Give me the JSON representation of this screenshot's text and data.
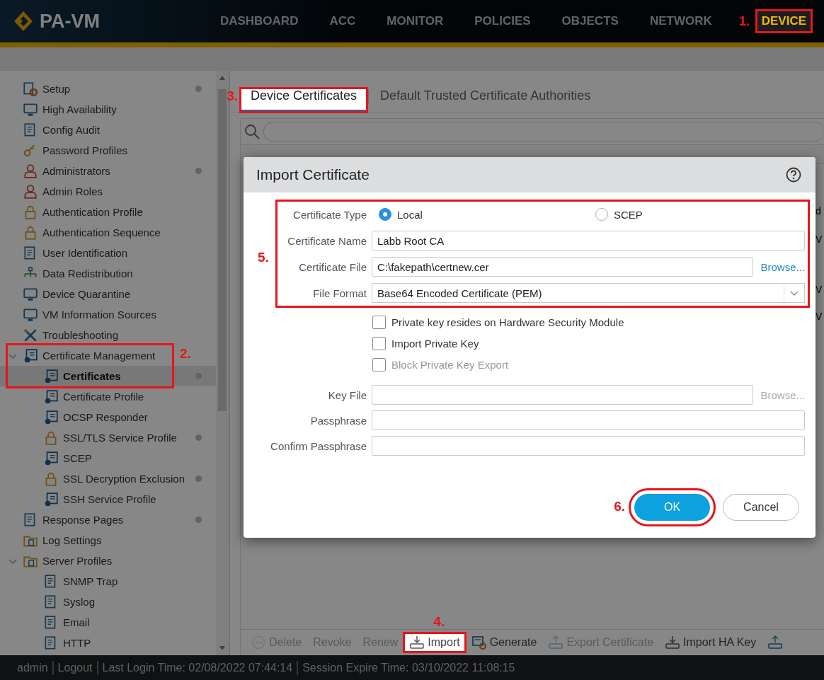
{
  "header": {
    "logo": "PA-VM",
    "nav": [
      {
        "label": "DASHBOARD",
        "selected": false
      },
      {
        "label": "ACC",
        "selected": false
      },
      {
        "label": "MONITOR",
        "selected": false
      },
      {
        "label": "POLICIES",
        "selected": false
      },
      {
        "label": "OBJECTS",
        "selected": false
      },
      {
        "label": "NETWORK",
        "selected": false
      },
      {
        "label": "DEVICE",
        "selected": true,
        "callout": "1."
      }
    ]
  },
  "sidebar": {
    "items": [
      {
        "label": "Setup",
        "selected": false,
        "dot": true
      },
      {
        "label": "High Availability",
        "selected": false,
        "dot": false
      },
      {
        "label": "Config Audit",
        "selected": false,
        "dot": false
      },
      {
        "label": "Password Profiles",
        "selected": false,
        "dot": false
      },
      {
        "label": "Administrators",
        "selected": false,
        "dot": true
      },
      {
        "label": "Admin Roles",
        "selected": false,
        "dot": false
      },
      {
        "label": "Authentication Profile",
        "selected": false,
        "dot": false
      },
      {
        "label": "Authentication Sequence",
        "selected": false,
        "dot": false
      },
      {
        "label": "User Identification",
        "selected": false,
        "dot": false
      },
      {
        "label": "Data Redistribution",
        "selected": false,
        "dot": false
      },
      {
        "label": "Device Quarantine",
        "selected": false,
        "dot": false
      },
      {
        "label": "VM Information Sources",
        "selected": false,
        "dot": false
      },
      {
        "label": "Troubleshooting",
        "selected": false,
        "dot": false
      },
      {
        "label": "Certificate Management",
        "selected": false,
        "dot": false,
        "expanded": true,
        "callout": "2.",
        "children": [
          {
            "label": "Certificates",
            "selected": true,
            "dot": true
          },
          {
            "label": "Certificate Profile",
            "selected": false,
            "dot": false
          },
          {
            "label": "OCSP Responder",
            "selected": false,
            "dot": false
          },
          {
            "label": "SSL/TLS Service Profile",
            "selected": false,
            "dot": true
          },
          {
            "label": "SCEP",
            "selected": false,
            "dot": false
          },
          {
            "label": "SSL Decryption Exclusion",
            "selected": false,
            "dot": true
          },
          {
            "label": "SSH Service Profile",
            "selected": false,
            "dot": false
          }
        ]
      },
      {
        "label": "Response Pages",
        "selected": false,
        "dot": true
      },
      {
        "label": "Log Settings",
        "selected": false,
        "dot": false
      },
      {
        "label": "Server Profiles",
        "selected": false,
        "dot": false,
        "expanded": true,
        "children": [
          {
            "label": "SNMP Trap",
            "selected": false,
            "dot": false
          },
          {
            "label": "Syslog",
            "selected": false,
            "dot": false
          },
          {
            "label": "Email",
            "selected": false,
            "dot": false
          },
          {
            "label": "HTTP",
            "selected": false,
            "dot": false
          }
        ]
      }
    ]
  },
  "tabs": [
    {
      "label": "Device Certificates",
      "selected": true,
      "callout": "3."
    },
    {
      "label": "Default Trusted Certificate Authorities",
      "selected": false
    }
  ],
  "table": {
    "rows": [
      {
        "column_1": "d"
      },
      {
        "column_1": "V"
      },
      {
        "column_1": "V"
      },
      {
        "column_1": "V"
      }
    ]
  },
  "toolbar": [
    {
      "kind": "delete",
      "label": "Delete",
      "disabled": true
    },
    {
      "kind": "plain",
      "label": "Revoke",
      "disabled": true
    },
    {
      "kind": "plain",
      "label": "Renew",
      "disabled": true
    },
    {
      "kind": "import",
      "label": "Import",
      "disabled": false,
      "callout": "4."
    },
    {
      "kind": "generate",
      "label": "Generate",
      "disabled": false
    },
    {
      "kind": "export",
      "label": "Export Certificate",
      "disabled": true
    },
    {
      "kind": "import",
      "label": "Import HA Key",
      "disabled": false
    },
    {
      "kind": "export",
      "disabled": false
    }
  ],
  "dialog": {
    "title": "Import Certificate",
    "groups": [
      {
        "callout": "5.",
        "fields": [
          {
            "kind": "radio",
            "label": "Certificate Type",
            "options": [
              {
                "label": "Local",
                "selected": true
              },
              {
                "label": "SCEP",
                "selected": false
              }
            ]
          },
          {
            "kind": "text",
            "label": "Certificate Name",
            "value": "Labb Root CA"
          },
          {
            "kind": "file",
            "label": "Certificate File",
            "value": "C:\\fakepath\\certnew.cer",
            "browse": "Browse...",
            "disabled": false
          },
          {
            "kind": "select",
            "label": "File Format",
            "value": "Base64 Encoded Certificate (PEM)"
          }
        ]
      },
      {
        "fields": [
          {
            "kind": "checkbox",
            "label": "Private key resides on Hardware Security Module",
            "checked": false,
            "disabled": false
          },
          {
            "kind": "checkbox",
            "label": "Import Private Key",
            "checked": false,
            "disabled": false
          },
          {
            "kind": "checkbox",
            "label": "Block Private Key Export",
            "checked": false,
            "disabled": true
          }
        ]
      },
      {
        "fields": [
          {
            "kind": "file",
            "label": "Key File",
            "browse": "Browse...",
            "disabled": true
          },
          {
            "kind": "password",
            "label": "Passphrase"
          },
          {
            "kind": "password",
            "label": "Confirm Passphrase"
          }
        ]
      }
    ],
    "buttons": [
      {
        "kind": "primary",
        "label": "OK",
        "callout": "6."
      },
      {
        "kind": "secondary",
        "label": "Cancel"
      }
    ]
  },
  "footer": {
    "user": "admin",
    "logout": "Logout",
    "last_login": "Last Login Time: 02/08/2022 07:44:14",
    "session_expire": "Session Expire Time: 03/10/2022 11:08:15"
  }
}
